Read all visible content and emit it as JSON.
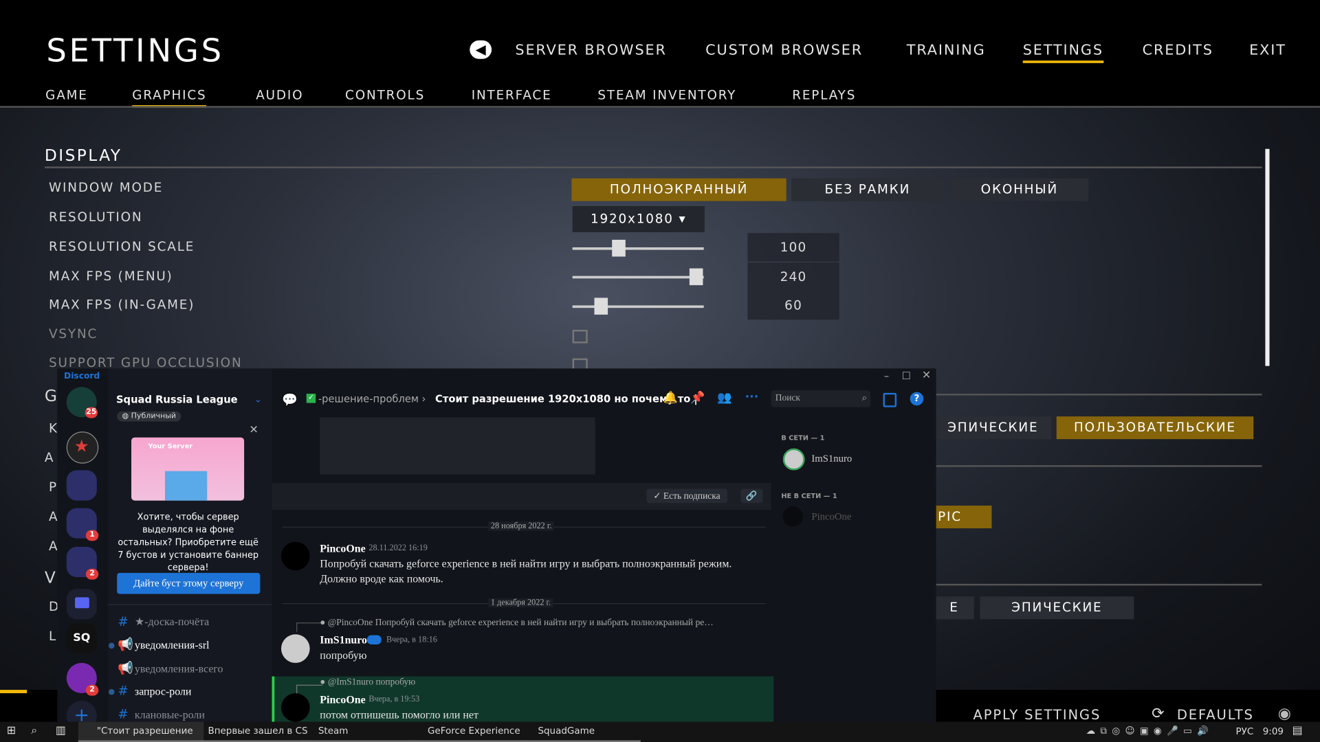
{
  "header": {
    "title": "SETTINGS",
    "nav": [
      "SERVER BROWSER",
      "CUSTOM BROWSER",
      "TRAINING",
      "SETTINGS",
      "CREDITS",
      "EXIT"
    ],
    "active_nav": "SETTINGS"
  },
  "tabs": [
    "GAME",
    "GRAPHICS",
    "AUDIO",
    "CONTROLS",
    "INTERFACE",
    "STEAM INVENTORY",
    "REPLAYS"
  ],
  "display": {
    "section": "DISPLAY",
    "window_mode": {
      "label": "WINDOW MODE",
      "options": [
        "ПОЛНОЭКРАННЫЙ",
        "БЕЗ РАМКИ",
        "ОКОННЫЙ"
      ],
      "selected": "ПОЛНОЭКРАННЫЙ"
    },
    "resolution": {
      "label": "RESOLUTION",
      "value": "1920x1080"
    },
    "resolution_scale": {
      "label": "RESOLUTION SCALE",
      "value": "100",
      "fraction": 0.35
    },
    "max_fps_menu": {
      "label": "MAX FPS (MENU)",
      "value": "240",
      "fraction": 0.94
    },
    "max_fps_ingame": {
      "label": "MAX FPS (IN-GAME)",
      "value": "60",
      "fraction": 0.22
    },
    "vsync": {
      "label": "VSYNC",
      "checked": false
    },
    "gpu_occlusion": {
      "label": "SUPPORT GPU OCCLUSION",
      "checked": false
    },
    "hidden_fragments": [
      "G",
      "K",
      "A",
      "P",
      "A",
      "A",
      "V",
      "D",
      "L"
    ],
    "quality_row1": [
      "ЭПИЧЕСКИЕ",
      "ПОЛЬЗОВАТЕЛЬСКИЕ"
    ],
    "quality_frag": "PIC",
    "quality_row2": [
      "E",
      "ЭПИЧЕСКИЕ"
    ]
  },
  "footer": {
    "apply": "APPLY SETTINGS",
    "defaults": "DEFAULTS"
  },
  "discord": {
    "brand": "Discord",
    "server_name": "Squad Russia League",
    "server_tag": "Публичный",
    "badges": [
      "25",
      "1",
      "2",
      "2"
    ],
    "boost": {
      "card_title": "Your Server",
      "text": "Хотите, чтобы сервер выделялся на фоне остальных? Приобретите ещё 7 бустов и установите баннер сервера!",
      "button": "Дайте буст этому серверу"
    },
    "channels": [
      {
        "name": "★-доска-почёта",
        "unread": false
      },
      {
        "name": "уведомления-srl",
        "unread": true
      },
      {
        "name": "уведомления-всего",
        "unread": false
      },
      {
        "name": "запрос-роли",
        "unread": true
      },
      {
        "name": "клановые-роли",
        "unread": false
      }
    ],
    "breadcrumb": {
      "forum": "-решение-проблем",
      "thread": "Стоит разрешение 1920x1080 но почему то |"
    },
    "search_placeholder": "Поиск",
    "subscribed": "Есть подписка",
    "messages": [
      {
        "divider": "28 ноября 2022 г."
      },
      {
        "author": "PincoOne",
        "time": "28.11.2022 16:19",
        "text": "Попробуй скачать geforce experience в ней найти игру и выбрать полноэкранный режим.",
        "text2": "Должно вроде как помочь."
      },
      {
        "divider": "1 декабря 2022 г."
      },
      {
        "reply": "@PincoOne Попробуй скачать geforce experience в ней найти игру и выбрать полноэкранный ре…",
        "author": "ImS1nuro",
        "time": "Вчера, в 18:16",
        "text": "попробую"
      },
      {
        "reply": "@ImS1nuro попробую",
        "author": "PincoOne",
        "time": "Вчера, в 19:53",
        "text": "потом отпишешь помогло или нет"
      }
    ],
    "members": {
      "online_header": "В СЕТИ — 1",
      "online": [
        "ImS1nuro"
      ],
      "offline_header": "НЕ В СЕТИ — 1",
      "offline": [
        "PincoOne"
      ]
    }
  },
  "taskbar": {
    "items": [
      "\"Стоит разрешение ...",
      "Впервые зашел в CS ...",
      "Steam",
      "GeForce Experience",
      "SquadGame"
    ],
    "lang": "РУС",
    "time": "9:09"
  },
  "colors": {
    "accent_gold": "#86640a",
    "tab_underline": "#f0b90b",
    "discord_blue": "#1e73d6",
    "highlight_green": "#10382a"
  }
}
